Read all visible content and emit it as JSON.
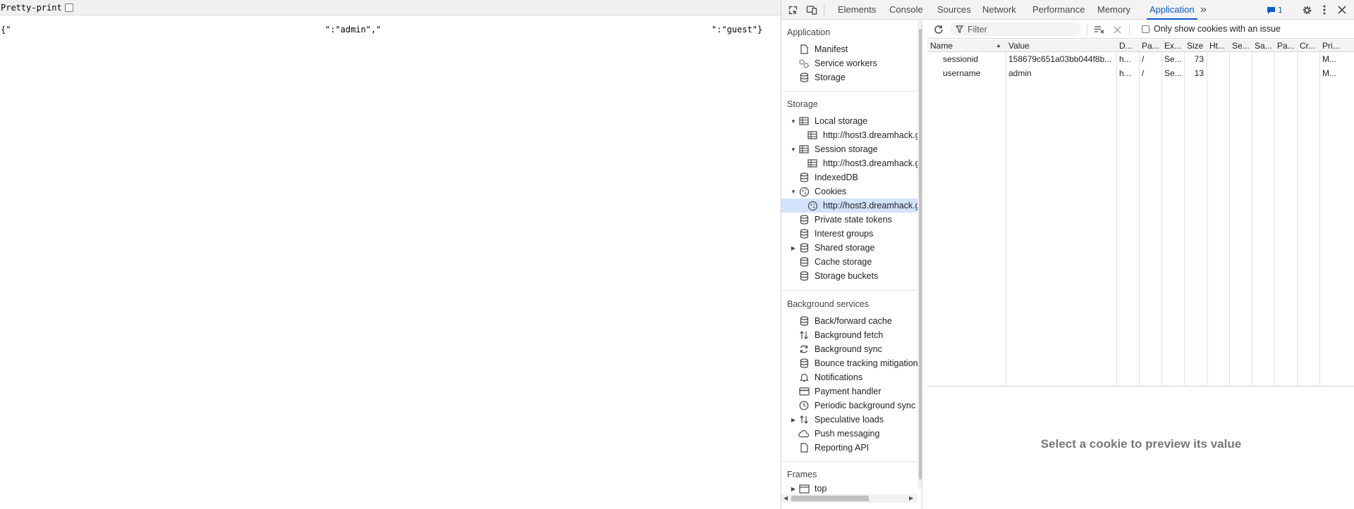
{
  "page": {
    "pretty_print_label": "Pretty-print",
    "pretty_print_checked": false,
    "json_fragments": [
      "{\"",
      "\":\"admin\",\"",
      "\":\"guest\"}"
    ]
  },
  "devtools": {
    "tabs": [
      "Elements",
      "Console",
      "Sources",
      "Network",
      "Performance",
      "Memory",
      "Application"
    ],
    "active_tab": "Application",
    "more_tabs_glyph": "»",
    "issues_count": "1",
    "colors": {
      "accent": "#0b57d0",
      "selection": "#d3e3fd"
    }
  },
  "sidebar": {
    "application_title": "Application",
    "application_items": [
      {
        "label": "Manifest",
        "icon": "document-icon"
      },
      {
        "label": "Service workers",
        "icon": "gears-icon"
      },
      {
        "label": "Storage",
        "icon": "database-icon"
      }
    ],
    "storage_title": "Storage",
    "storage_items": [
      {
        "label": "Local storage",
        "icon": "table-icon",
        "expanded": true
      },
      {
        "label": "http://host3.dreamhack.g",
        "icon": "table-icon",
        "child": true
      },
      {
        "label": "Session storage",
        "icon": "table-icon",
        "expanded": true
      },
      {
        "label": "http://host3.dreamhack.g",
        "icon": "table-icon",
        "child": true
      },
      {
        "label": "IndexedDB",
        "icon": "database-icon"
      },
      {
        "label": "Cookies",
        "icon": "cookie-icon",
        "expanded": true
      },
      {
        "label": "http://host3.dreamhack.g",
        "icon": "cookie-icon",
        "child": true,
        "selected": true
      },
      {
        "label": "Private state tokens",
        "icon": "database-icon"
      },
      {
        "label": "Interest groups",
        "icon": "database-icon"
      },
      {
        "label": "Shared storage",
        "icon": "database-icon",
        "collapsed": true
      },
      {
        "label": "Cache storage",
        "icon": "database-icon"
      },
      {
        "label": "Storage buckets",
        "icon": "database-icon"
      }
    ],
    "background_title": "Background services",
    "background_items": [
      {
        "label": "Back/forward cache",
        "icon": "database-icon"
      },
      {
        "label": "Background fetch",
        "icon": "updown-arrows-icon"
      },
      {
        "label": "Background sync",
        "icon": "sync-icon"
      },
      {
        "label": "Bounce tracking mitigation",
        "icon": "database-icon"
      },
      {
        "label": "Notifications",
        "icon": "bell-icon"
      },
      {
        "label": "Payment handler",
        "icon": "card-icon"
      },
      {
        "label": "Periodic background sync",
        "icon": "clock-icon"
      },
      {
        "label": "Speculative loads",
        "icon": "updown-arrows-icon",
        "collapsed": true
      },
      {
        "label": "Push messaging",
        "icon": "cloud-icon"
      },
      {
        "label": "Reporting API",
        "icon": "document-icon"
      }
    ],
    "frames_title": "Frames",
    "frames_items": [
      {
        "label": "top",
        "icon": "frame-icon",
        "collapsed": true
      }
    ]
  },
  "cookies": {
    "filter_placeholder": "Filter",
    "only_issues_label": "Only show cookies with an issue",
    "columns": [
      "Name",
      "Value",
      "D...",
      "Pa...",
      "Ex...",
      "Size",
      "Ht...",
      "Se...",
      "Sa...",
      "Pa...",
      "Cr...",
      "Pri..."
    ],
    "sort_column": "Name",
    "sort_direction": "ascending",
    "rows": [
      [
        "sessionid",
        "158679c651a03bb044f8b...",
        "h...",
        "/",
        "Se...",
        "73",
        "",
        "",
        "",
        "",
        "",
        "M..."
      ],
      [
        "username",
        "admin",
        "h...",
        "/",
        "Se...",
        "13",
        "",
        "",
        "",
        "",
        "",
        "M..."
      ]
    ],
    "preview_message": "Select a cookie to preview its value"
  }
}
